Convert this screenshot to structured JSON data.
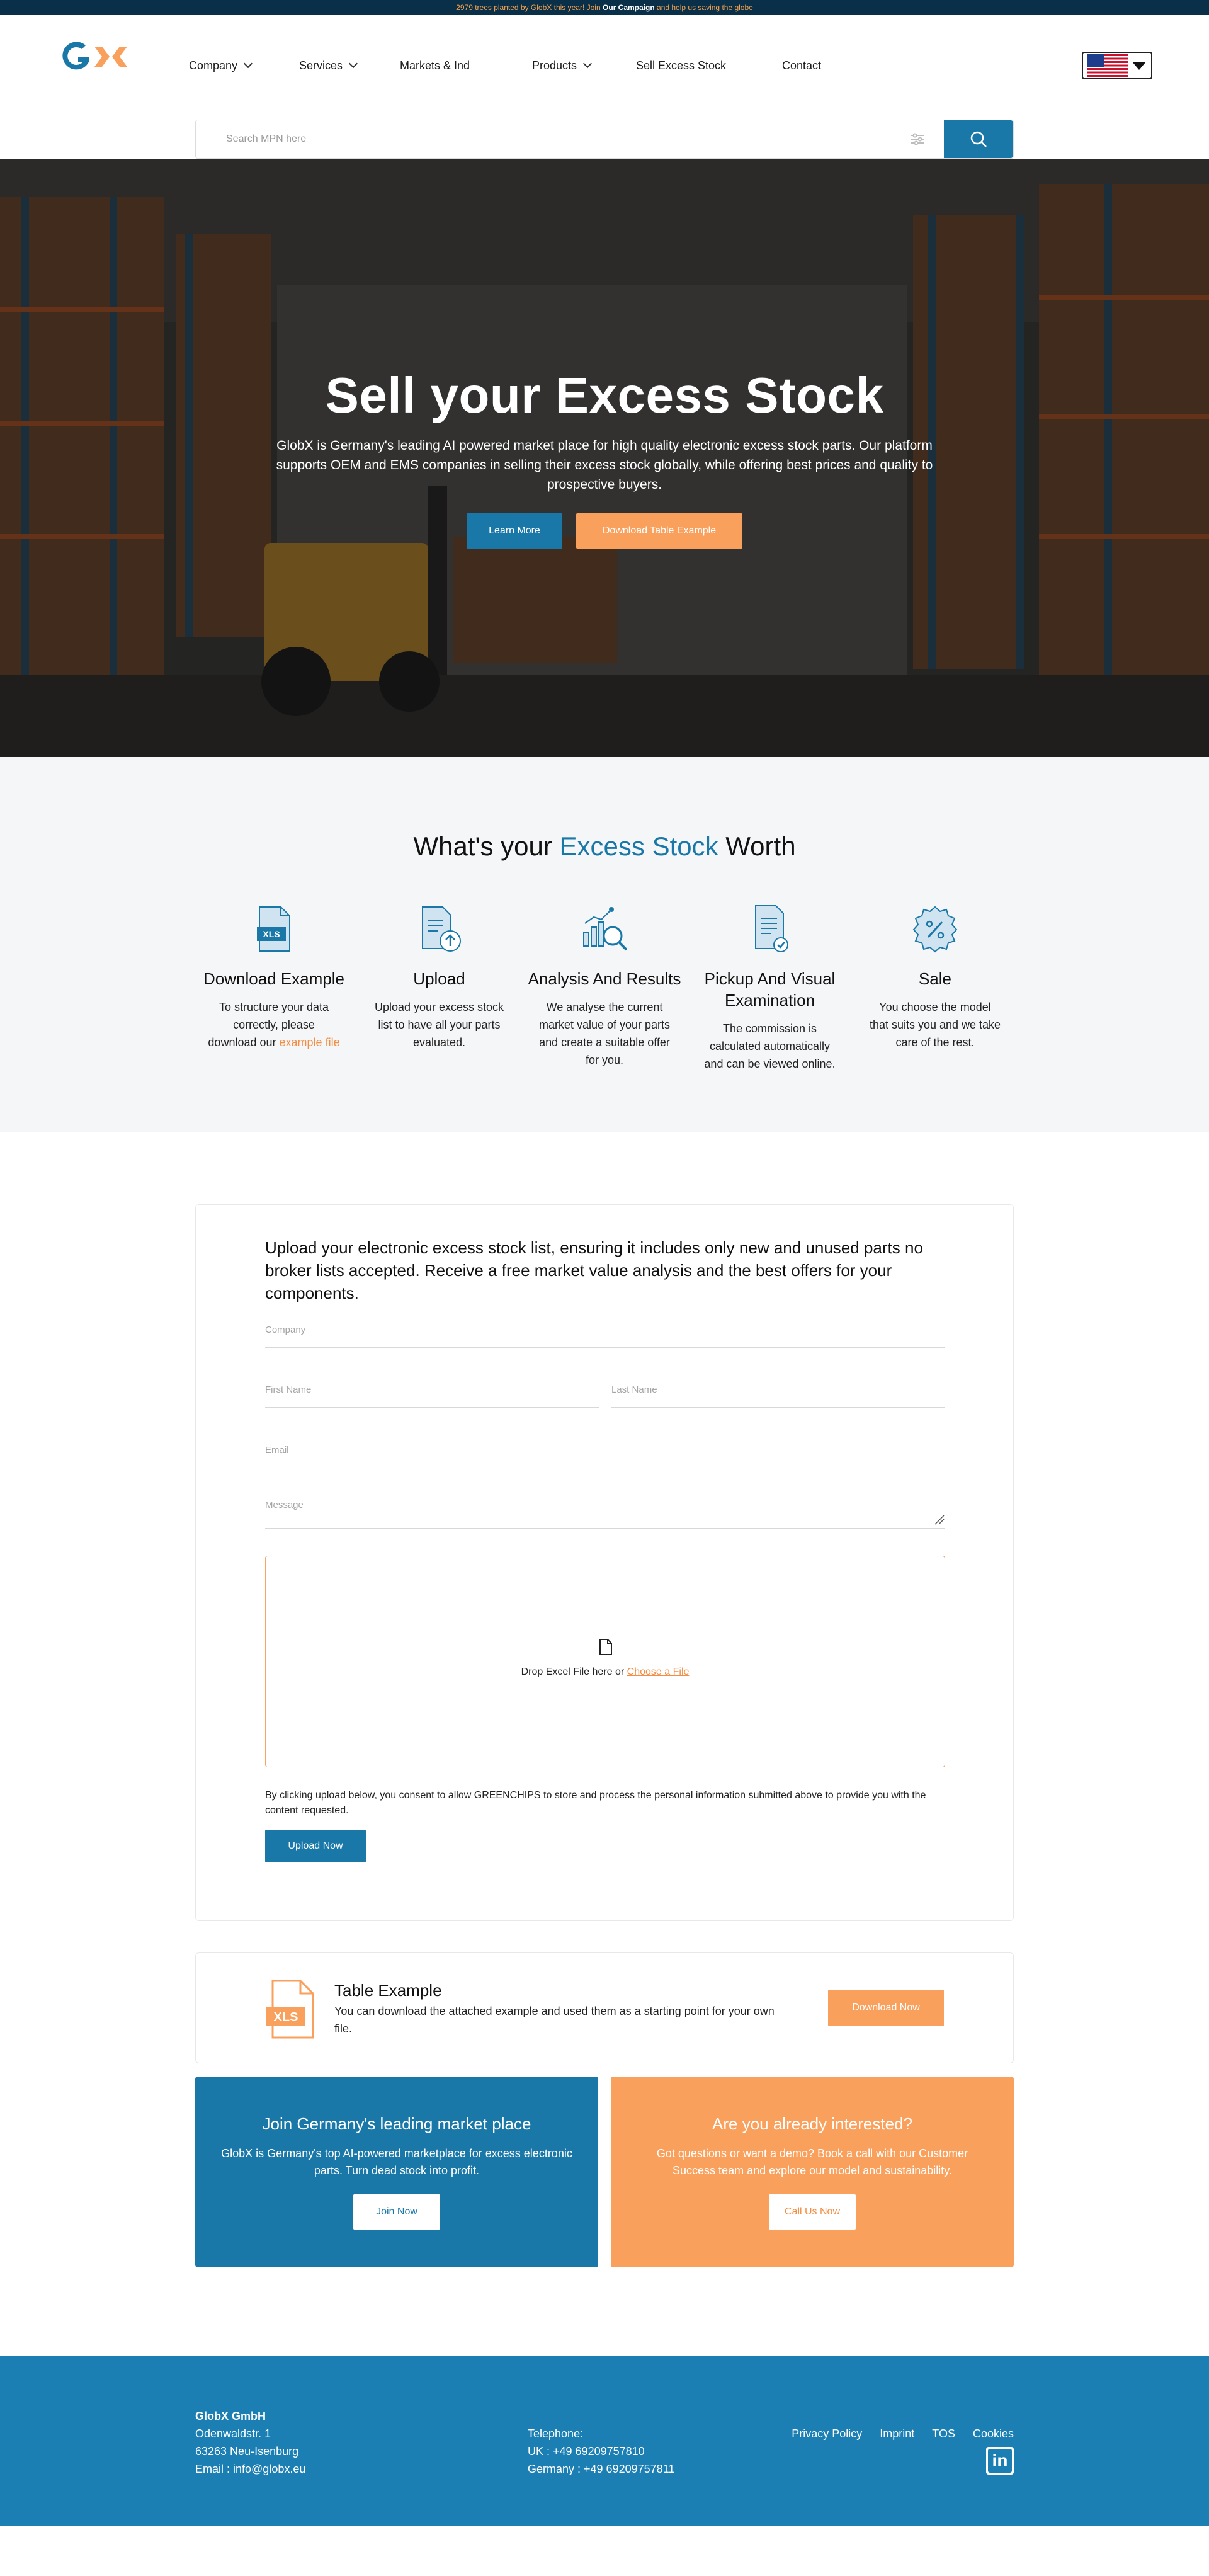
{
  "topbar": {
    "text": "2979 trees planted by GlobX this year! Join",
    "link": "Our Campaign",
    "text_after": "and help us saving the globe"
  },
  "nav": {
    "items": [
      {
        "label": "Company",
        "has_dropdown": true
      },
      {
        "label": "Services",
        "has_dropdown": true
      },
      {
        "label": "Markets & Ind",
        "has_dropdown": false
      },
      {
        "label": "Products",
        "has_dropdown": true
      },
      {
        "label": "Sell Excess Stock",
        "has_dropdown": false
      },
      {
        "label": "Contact",
        "has_dropdown": false
      }
    ],
    "language_icon": "us-flag-icon"
  },
  "search": {
    "placeholder": "Search MPN here"
  },
  "hero": {
    "title": "Sell your Excess Stock",
    "subtitle": "GlobX is Germany's leading AI powered market place for high quality electronic excess stock parts. Our platform supports OEM and EMS companies in selling their excess stock globally, while offering best prices and quality to prospective buyers.",
    "btn_learn": "Learn More",
    "btn_download": "Download Table Example"
  },
  "worth": {
    "title_pre": "What's your",
    "title_accent": "Excess Stock",
    "title_post": "Worth",
    "steps": [
      {
        "title": "Download Example",
        "text": "To structure your data correctly, please download our",
        "link": "example file",
        "icon": "xls-file-icon"
      },
      {
        "title": "Upload",
        "text": "Upload your excess stock list to have all your parts evaluated.",
        "icon": "upload-document-icon"
      },
      {
        "title": "Analysis And Results",
        "text": "We analyse the current market value of your parts and create a suitable offer for you.",
        "icon": "analysis-chart-icon"
      },
      {
        "title": "Pickup And Visual Examination",
        "text": "The commission is calculated automatically and can be viewed online.",
        "icon": "checked-document-icon"
      },
      {
        "title": "Sale",
        "text": "You choose the model that suits you and we take care of the rest.",
        "icon": "percent-badge-icon"
      }
    ]
  },
  "form": {
    "title": "Upload your electronic excess stock list, ensuring it includes only new and unused parts no broker lists accepted. Receive a free market value analysis and the best offers for your components.",
    "company_placeholder": "Company",
    "first_name_placeholder": "First Name",
    "last_name_placeholder": "Last Name",
    "email_placeholder": "Email",
    "message_placeholder": "Message",
    "drop_text": "Drop Excel File here or",
    "drop_link": "Choose a File",
    "consent": "By clicking upload below, you consent to allow GREENCHIPS to store and process the personal information submitted above to provide you with the content requested.",
    "upload_label": "Upload Now"
  },
  "table_example": {
    "title": "Table Example",
    "text": "You can download the attached example and used them as a starting point for your own file.",
    "button": "Download Now",
    "icon_label": "XLS"
  },
  "cta": {
    "left": {
      "title": "Join Germany's leading market place",
      "text": "GlobX is Germany's top AI-powered marketplace for excess electronic parts. Turn dead stock into profit.",
      "button": "Join Now"
    },
    "right": {
      "title": "Are you already interested?",
      "text": "Got questions or want a demo? Book a call with our Customer Success team and explore our model and sustainability.",
      "button": "Call Us Now"
    }
  },
  "footer": {
    "company": "GlobX GmbH",
    "street": "Odenwaldstr. 1",
    "city": "63263 Neu-Isenburg",
    "email": "Email : info@globx.eu",
    "tel_label": "Telephone:",
    "tel_uk": "UK : +49 69209757810",
    "tel_de": "Germany : +49 69209757811",
    "links": [
      "Privacy Policy",
      "Imprint",
      "TOS",
      "Cookies"
    ],
    "linkedin_icon": "in"
  },
  "colors": {
    "brand_blue": "#1a78a8",
    "brand_orange": "#f9a05c",
    "topbar": "#0a2f48",
    "footer": "#1b7fb4"
  }
}
